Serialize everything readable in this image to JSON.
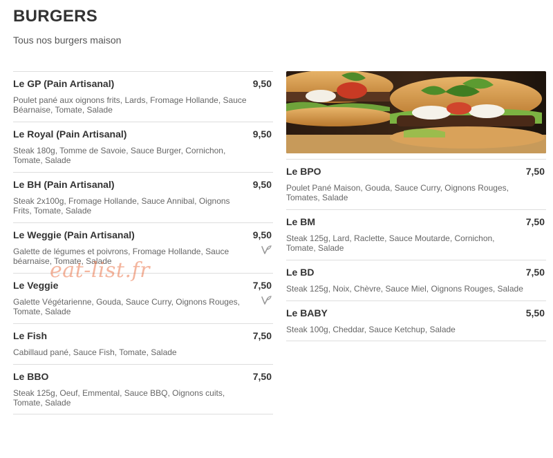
{
  "header": {
    "title": "BURGERS",
    "subtitle": "Tous nos burgers maison"
  },
  "left_items": [
    {
      "name": "Le GP (Pain Artisanal)",
      "price": "9,50",
      "desc": "Poulet pané aux oignons frits, Lards, Fromage Hollande, Sauce Béarnaise, Tomate, Salade",
      "veg": false
    },
    {
      "name": "Le Royal (Pain Artisanal)",
      "price": "9,50",
      "desc": "Steak 180g, Tomme de Savoie, Sauce Burger, Cornichon, Tomate, Salade",
      "veg": false
    },
    {
      "name": "Le BH (Pain Artisanal)",
      "price": "9,50",
      "desc": "Steak 2x100g, Fromage Hollande, Sauce Annibal, Oignons Frits, Tomate, Salade",
      "veg": false
    },
    {
      "name": "Le Weggie (Pain Artisanal)",
      "price": "9,50",
      "desc": "Galette de légumes et poivrons, Fromage Hollande, Sauce béarnaise, Tomate, Salade",
      "veg": true
    },
    {
      "name": "Le Veggie",
      "price": "7,50",
      "desc": "Galette Végétarienne, Gouda, Sauce Curry, Oignons Rouges, Tomate, Salade",
      "veg": true
    },
    {
      "name": "Le Fish",
      "price": "7,50",
      "desc": "Cabillaud pané, Sauce Fish, Tomate, Salade",
      "veg": false
    },
    {
      "name": "Le BBO",
      "price": "7,50",
      "desc": "Steak 125g, Oeuf, Emmental, Sauce BBQ, Oignons cuits, Tomate, Salade",
      "veg": false
    }
  ],
  "right_items": [
    {
      "name": "Le BPO",
      "price": "7,50",
      "desc": "Poulet Pané Maison, Gouda, Sauce Curry, Oignons Rouges, Tomates, Salade",
      "veg": false
    },
    {
      "name": "Le BM",
      "price": "7,50",
      "desc": "Steak 125g, Lard, Raclette, Sauce Moutarde, Cornichon, Tomate, Salade",
      "veg": false
    },
    {
      "name": "Le BD",
      "price": "7,50",
      "desc": "Steak 125g, Noix, Chèvre, Sauce Miel, Oignons Rouges, Salade",
      "veg": false
    },
    {
      "name": "Le BABY",
      "price": "5,50",
      "desc": "Steak 100g, Cheddar, Sauce Ketchup, Salade",
      "veg": false
    }
  ],
  "watermark": "eat-list.fr",
  "colors": {
    "veg_icon": "#999999",
    "watermark": "#e65a28"
  }
}
